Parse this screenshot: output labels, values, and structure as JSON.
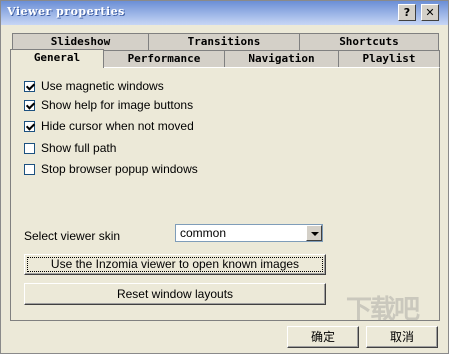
{
  "window": {
    "title": "Viewer properties"
  },
  "titlebar_buttons": {
    "help": "?",
    "close": "✕"
  },
  "tabs_row1": [
    "Slideshow",
    "Transitions",
    "Shortcuts"
  ],
  "tabs_row2": [
    "General",
    "Performance",
    "Navigation",
    "Playlist"
  ],
  "active_tab": "General",
  "checkboxes": [
    {
      "label": "Use magnetic windows",
      "checked": true
    },
    {
      "label": "Show help for image buttons",
      "checked": true
    },
    {
      "label": "Hide cursor when not moved",
      "checked": true
    },
    {
      "label": "Show full path",
      "checked": false
    },
    {
      "label": "Stop browser popup windows",
      "checked": false
    }
  ],
  "skin": {
    "label": "Select viewer skin",
    "value": "common"
  },
  "buttons": {
    "use_inzomia": "Use the Inzomia viewer to open known images",
    "reset_layouts": "Reset window layouts",
    "ok": "确定",
    "cancel": "取消"
  },
  "watermark": "下载吧"
}
